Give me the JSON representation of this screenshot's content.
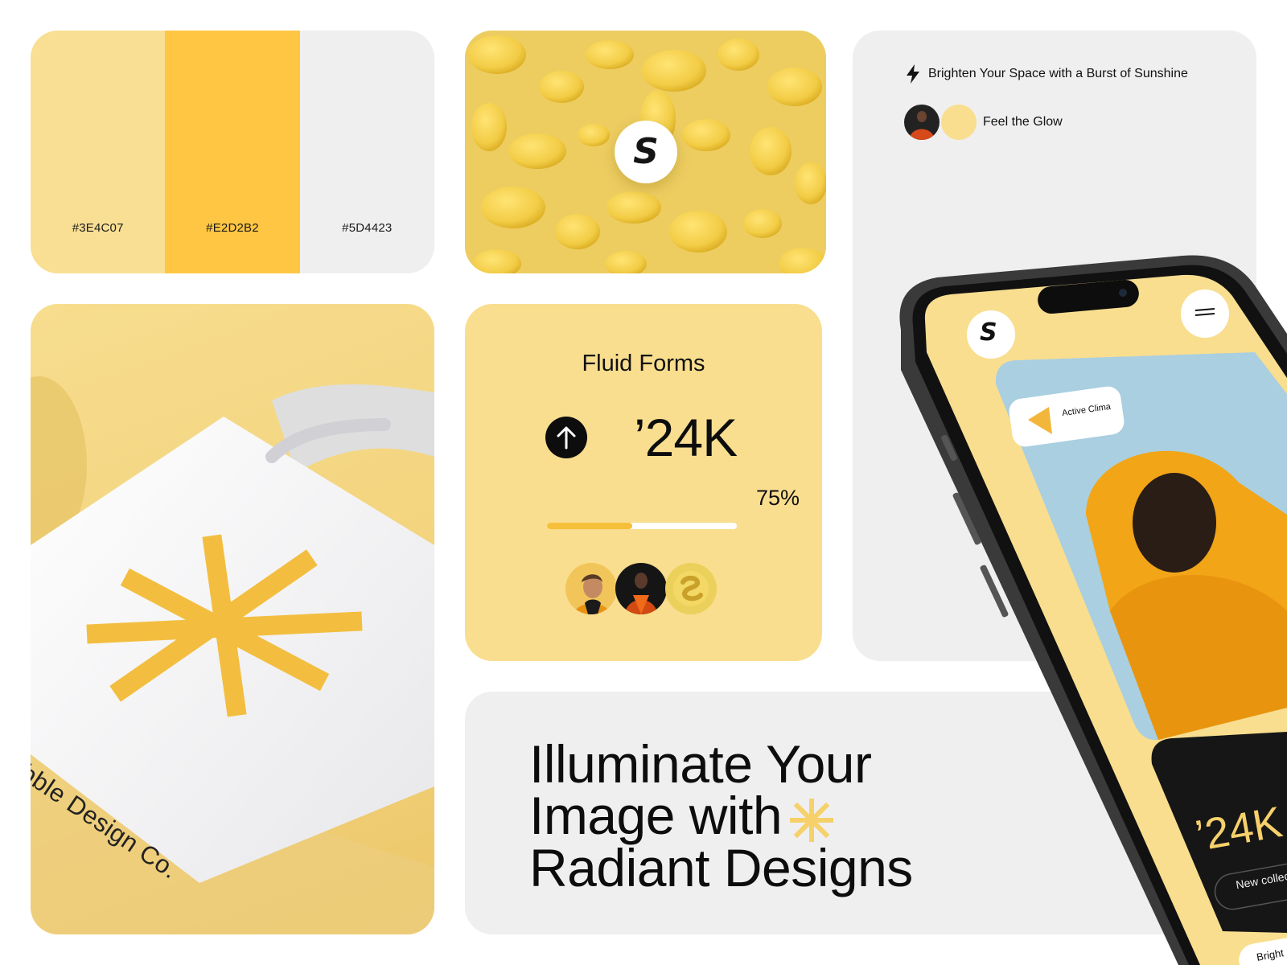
{
  "palette": {
    "swatches": [
      {
        "label": "#3E4C07",
        "color": "#f9df93"
      },
      {
        "label": "#E2D2B2",
        "color": "#fec642"
      },
      {
        "label": "#5D4423",
        "color": "#efefef"
      }
    ]
  },
  "brand": {
    "logo_letter": "S"
  },
  "tote": {
    "printed_text": "ubble Design Co."
  },
  "stats": {
    "title": "Fluid Forms",
    "value": "’24K",
    "percent_label": "75%",
    "progress": 0.45
  },
  "promo": {
    "tagline": "Brighten Your Space with a Burst of Sunshine",
    "glow_label": "Feel the Glow"
  },
  "headline": {
    "line1": "Illuminate Your",
    "line2": "Image with",
    "line3": "Radiant Designs"
  },
  "phone": {
    "badge_label": "Active Clima",
    "dark_card_value": "’24K",
    "dark_card_button": "New collecti",
    "bottom_pill": "Bright"
  },
  "colors": {
    "yellow_light": "#f9de8f",
    "yellow": "#fec642",
    "grey": "#efefef",
    "dark": "#0d0d0d"
  }
}
